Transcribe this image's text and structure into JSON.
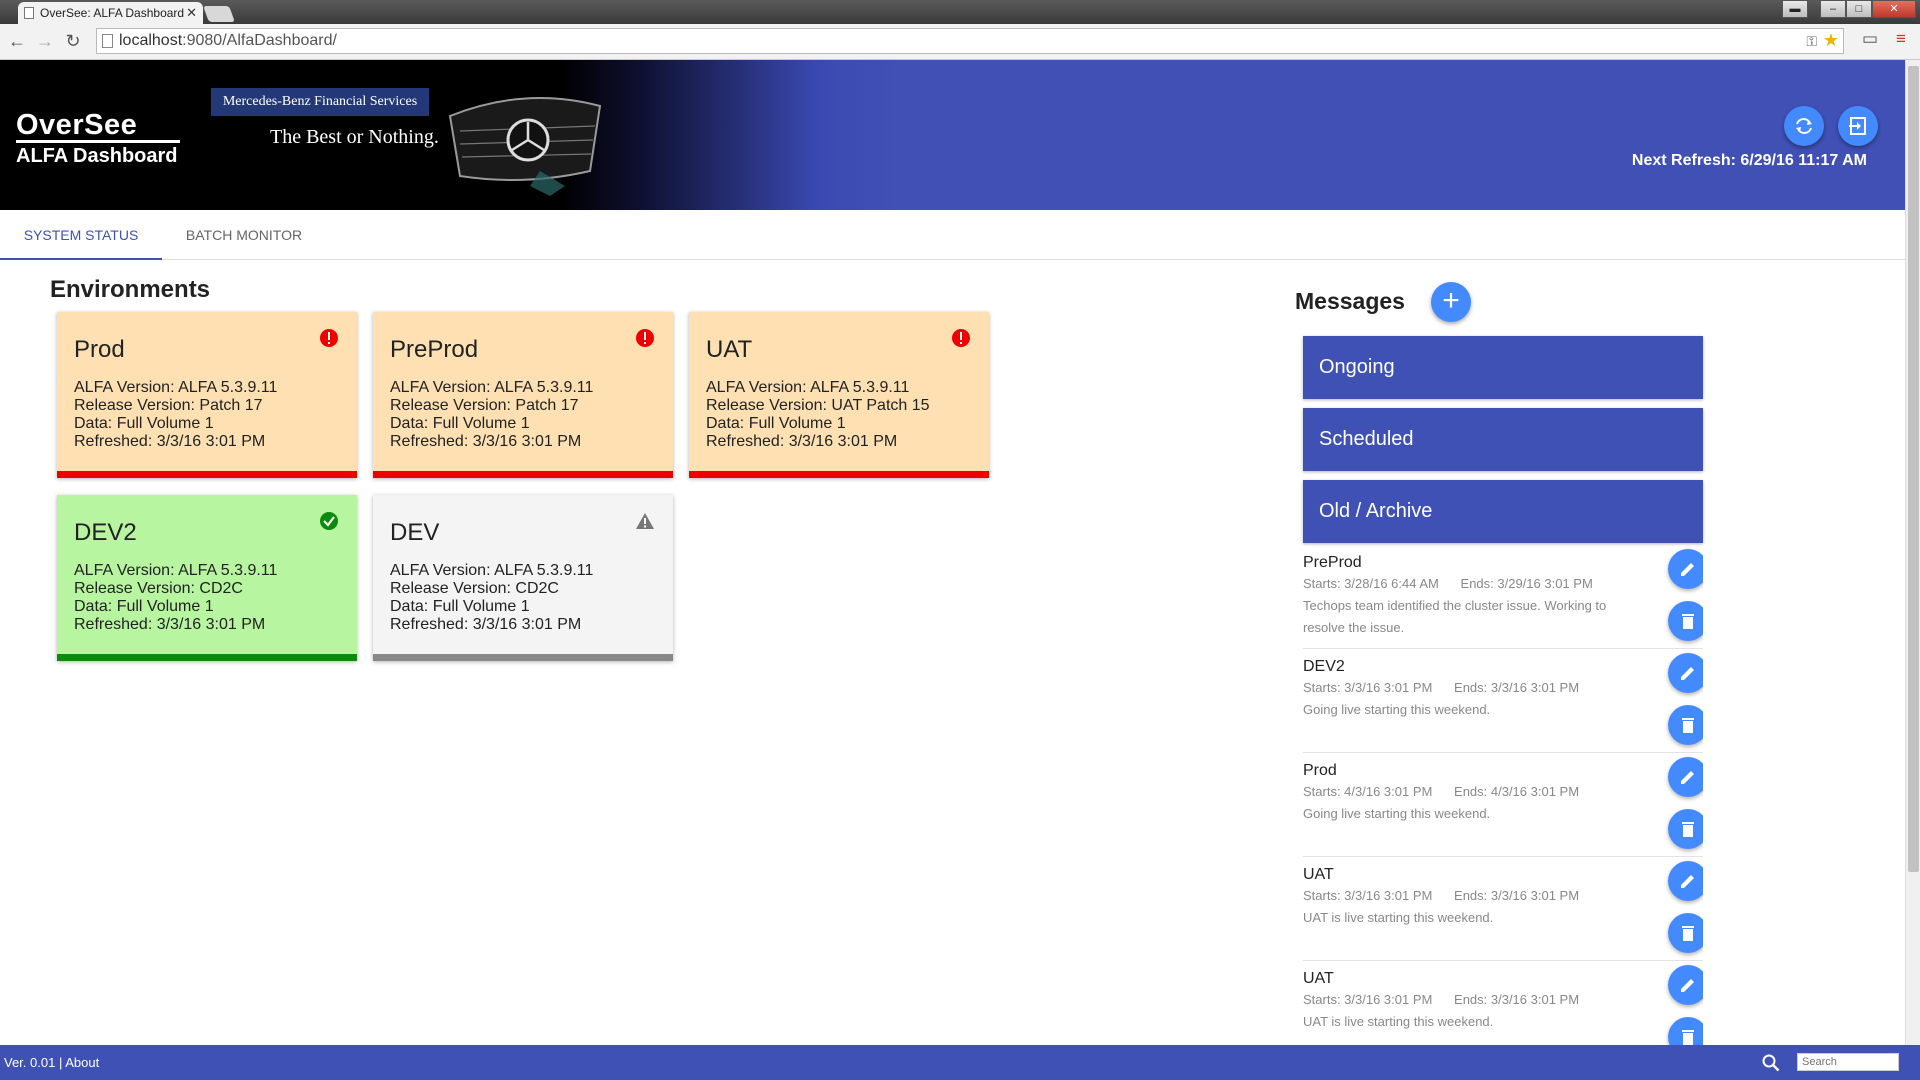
{
  "browser": {
    "tab_title": "OverSee: ALFA Dashboard",
    "url_host": "localhost",
    "url_path": ":9080/AlfaDashboard/"
  },
  "header": {
    "brand_title": "OverSee",
    "brand_subtitle": "ALFA Dashboard",
    "banner_company": "Mercedes-Benz Financial Services",
    "banner_tagline": "The Best or Nothing.",
    "next_refresh": "Next Refresh: 6/29/16 11:17 AM",
    "refresh_icon": "refresh-icon",
    "logout_icon": "logout-icon"
  },
  "tabs": [
    {
      "label": "SYSTEM STATUS",
      "active": true
    },
    {
      "label": "BATCH MONITOR",
      "active": false
    }
  ],
  "environments": {
    "title": "Environments",
    "cards": [
      {
        "name": "Prod",
        "alfa": "ALFA Version: ALFA 5.3.9.11",
        "release": "Release Version: Patch 17",
        "data": "Data: Full Volume 1",
        "refreshed": "Refreshed: 3/3/16 3:01 PM",
        "status": "error",
        "status_color": "#e00000"
      },
      {
        "name": "PreProd",
        "alfa": "ALFA Version: ALFA 5.3.9.11",
        "release": "Release Version: Patch 17",
        "data": "Data: Full Volume 1",
        "refreshed": "Refreshed: 3/3/16 3:01 PM",
        "status": "error",
        "status_color": "#e00000"
      },
      {
        "name": "UAT",
        "alfa": "ALFA Version: ALFA 5.3.9.11",
        "release": "Release Version: UAT Patch 15",
        "data": "Data: Full Volume 1",
        "refreshed": "Refreshed: 3/3/16 3:01 PM",
        "status": "error",
        "status_color": "#e00000"
      },
      {
        "name": "DEV2",
        "alfa": "ALFA Version: ALFA 5.3.9.11",
        "release": "Release Version: CD2C",
        "data": "Data: Full Volume 1",
        "refreshed": "Refreshed: 3/3/16 3:01 PM",
        "status": "ok",
        "status_color": "#0b8a0b"
      },
      {
        "name": "DEV",
        "alfa": "ALFA Version: ALFA 5.3.9.11",
        "release": "Release Version: CD2C",
        "data": "Data: Full Volume 1",
        "refreshed": "Refreshed: 3/3/16 3:01 PM",
        "status": "warning",
        "status_color": "#777777"
      }
    ]
  },
  "messages": {
    "title": "Messages",
    "sections": [
      "Ongoing",
      "Scheduled",
      "Old / Archive"
    ],
    "items": [
      {
        "name": "PreProd",
        "dates": "Starts: 3/28/16 6:44 AM      Ends: 3/29/16 3:01 PM",
        "text": "Techops team identified the cluster issue. Working to resolve the issue."
      },
      {
        "name": "DEV2",
        "dates": "Starts: 3/3/16 3:01 PM      Ends: 3/3/16 3:01 PM",
        "text": "Going live starting this weekend."
      },
      {
        "name": "Prod",
        "dates": "Starts: 4/3/16 3:01 PM      Ends: 4/3/16 3:01 PM",
        "text": "Going live starting this weekend."
      },
      {
        "name": "UAT",
        "dates": "Starts: 3/3/16 3:01 PM      Ends: 3/3/16 3:01 PM",
        "text": "UAT is live starting this weekend."
      },
      {
        "name": "UAT",
        "dates": "Starts: 3/3/16 3:01 PM      Ends: 3/3/16 3:01 PM",
        "text": "UAT is live starting this weekend."
      }
    ]
  },
  "footer": {
    "version": "Ver. 0.01",
    "separator": " | ",
    "about": "About",
    "search_placeholder": "Search"
  },
  "colors": {
    "primary": "#3f51b5",
    "accent": "#448aff",
    "error": "#e00000",
    "ok": "#0b8a0b"
  }
}
